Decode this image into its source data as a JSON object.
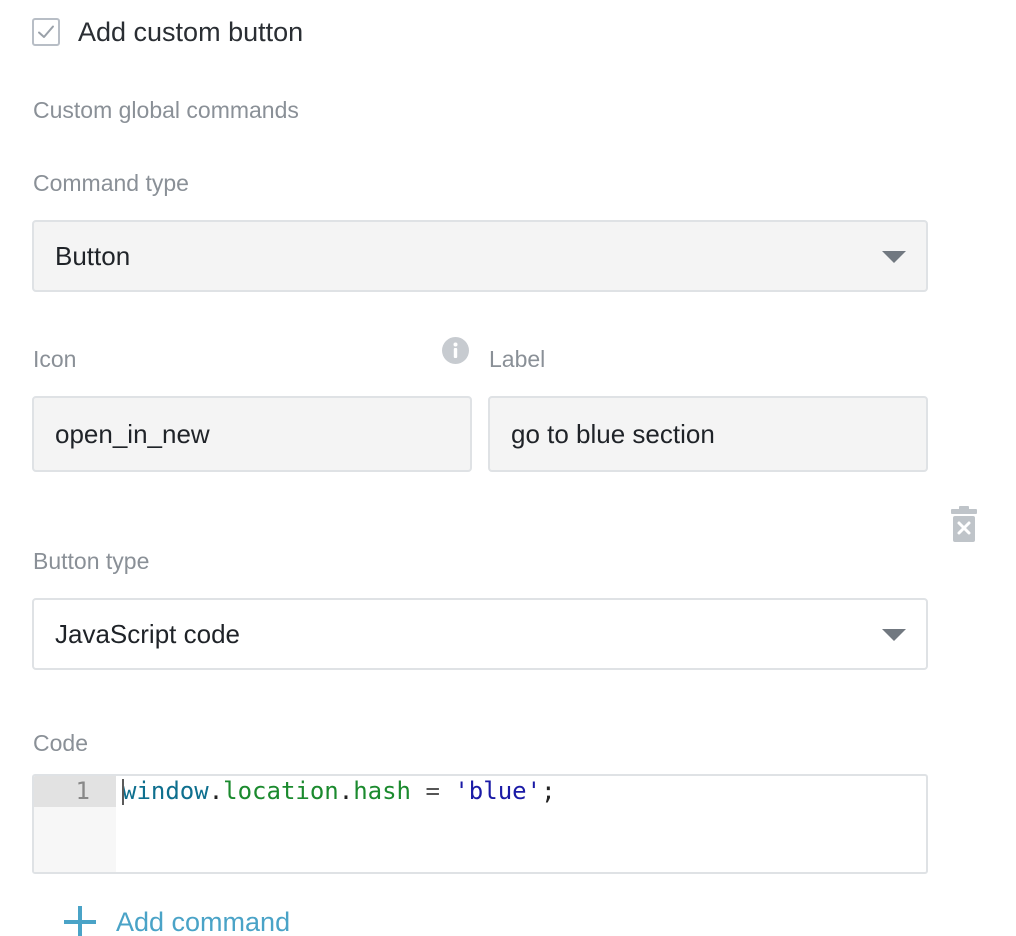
{
  "custom_button": {
    "checkbox_label": "Add custom button",
    "checked": true
  },
  "section": {
    "heading": "Custom global commands"
  },
  "command_type": {
    "label": "Command type",
    "selected": "Button"
  },
  "icon_field": {
    "label": "Icon",
    "value": "open_in_new"
  },
  "label_field": {
    "label": "Label",
    "value": "go to blue section"
  },
  "button_type": {
    "label": "Button type",
    "selected": "JavaScript code"
  },
  "code": {
    "label": "Code",
    "line_number": "1",
    "tokens": {
      "t1": "window",
      "t2": ".",
      "t3": "location",
      "t4": ".",
      "t5": "hash",
      "t6": " = ",
      "t7": "'blue'",
      "t8": ";"
    }
  },
  "actions": {
    "add_command": "Add command"
  },
  "icons": {
    "checkbox": "check-icon",
    "info": "info-icon",
    "trash": "trash-icon",
    "add": "plus-icon",
    "dropdown": "chevron-down-icon"
  },
  "colors": {
    "accent": "#4aa3c7",
    "muted_label": "#8a9097",
    "field_bg": "#f4f4f4"
  }
}
